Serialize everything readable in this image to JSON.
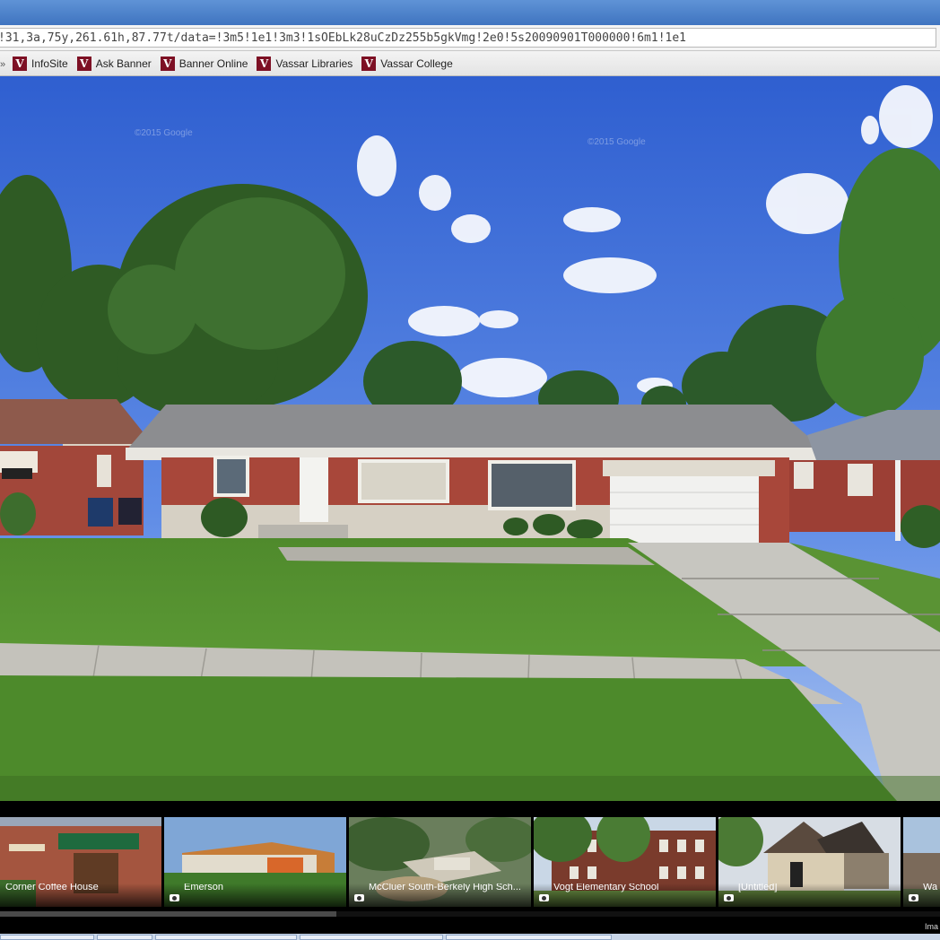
{
  "browser": {
    "address": "!31,3a,75y,261.61h,87.77t/data=!3m5!1e1!3m3!1sOEbLk28uCzDz255b5gkVmg!2e0!5s20090901T000000!6m1!1e1",
    "bookmarks": [
      {
        "label": "InfoSite",
        "icon": "vassar-v-icon"
      },
      {
        "label": "Ask Banner",
        "icon": "vassar-v-icon"
      },
      {
        "label": "Banner Online",
        "icon": "vassar-v-icon"
      },
      {
        "label": "Vassar Libraries",
        "icon": "vassar-v-icon"
      },
      {
        "label": "Vassar College",
        "icon": "vassar-v-icon"
      }
    ]
  },
  "street_view": {
    "watermark_left": "©2015 Google",
    "watermark_right": "©2015 Google"
  },
  "filmstrip": {
    "thumbnails": [
      {
        "label": "Corner Coffee House",
        "has_camera_icon": false
      },
      {
        "label": "Emerson",
        "has_camera_icon": true
      },
      {
        "label": "McCluer South-Berkely High Sch...",
        "has_camera_icon": true
      },
      {
        "label": "Vogt Elementary School",
        "has_camera_icon": true
      },
      {
        "label": "[Untitled]",
        "has_camera_icon": true
      },
      {
        "label": "Wa",
        "has_camera_icon": true
      }
    ],
    "imagery_text": "Ima"
  },
  "colors": {
    "sky": "#4f80e0",
    "grass": "#5d9a36",
    "brick": "#a44a3c",
    "roof": "#8c8c8c",
    "accent_bookmark": "#7d1024"
  }
}
